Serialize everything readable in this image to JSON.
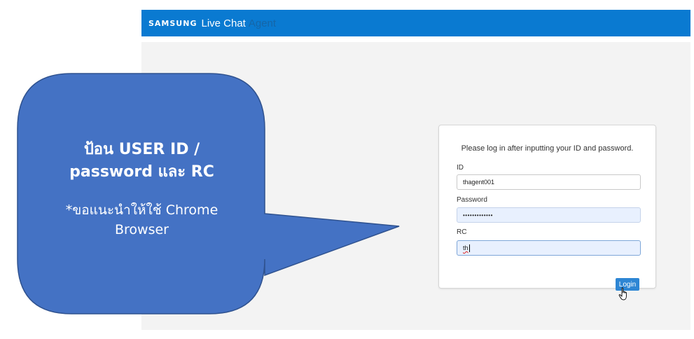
{
  "header": {
    "brand": "SAMSUNG",
    "product": "Live Chat",
    "role": "Agent"
  },
  "login": {
    "instruction": "Please log in after inputting your ID and password.",
    "id_label": "ID",
    "id_value": "thagent001",
    "password_label": "Password",
    "password_value": "•••••••••••••",
    "rc_label": "RC",
    "rc_value": "th",
    "login_label": "Login"
  },
  "callout": {
    "title_line1": "ป้อน USER  ID /",
    "title_line2": "password และ RC",
    "subtitle_line1": "*ขอแนะนำให้ใช้ Chrome",
    "subtitle_line2": "Browser"
  },
  "colors": {
    "header_bg": "#0a7ad1",
    "callout_fill": "#4472c4",
    "callout_border": "#2f528f",
    "button_bg": "#2e86d4"
  },
  "icons": {
    "cursor": "hand-pointer-icon"
  }
}
